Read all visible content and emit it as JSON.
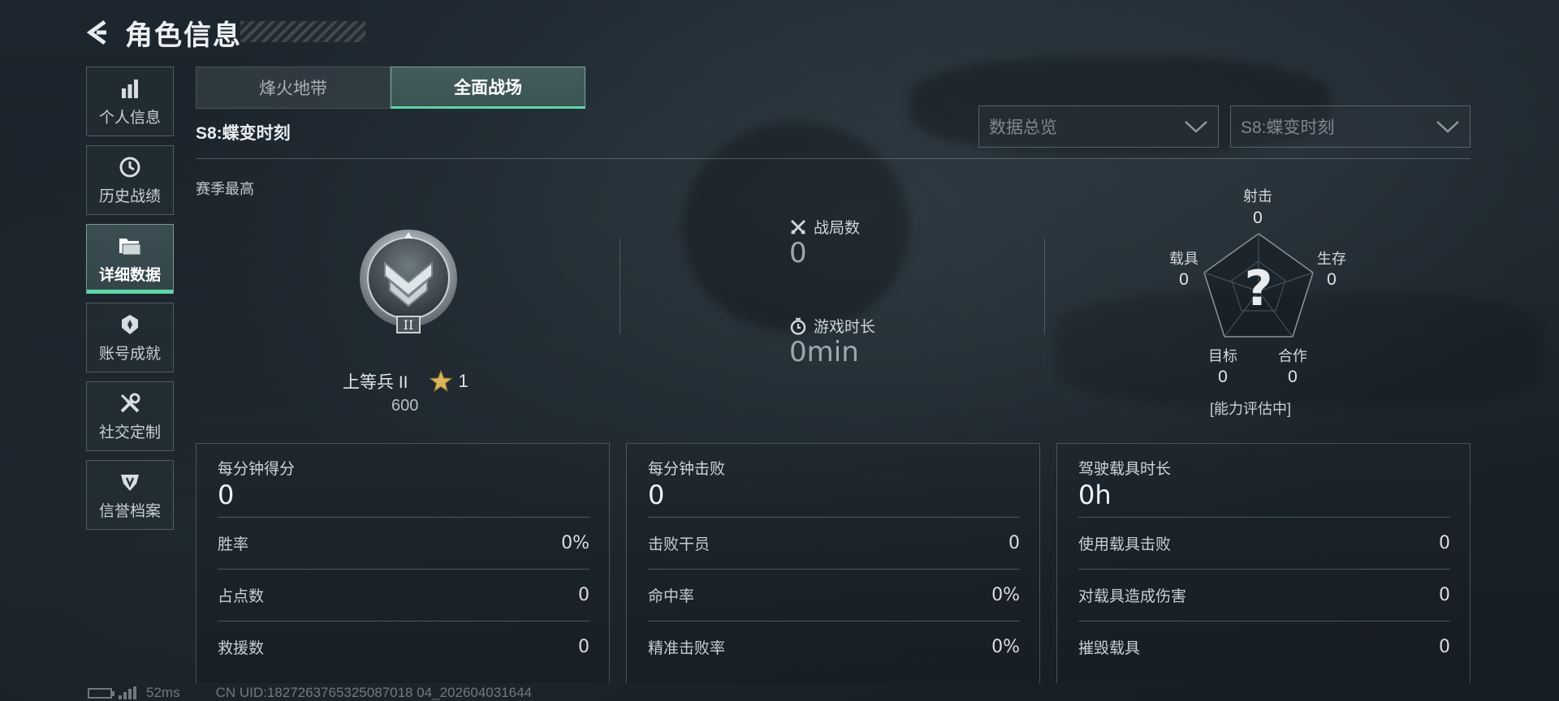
{
  "header": {
    "title": "角色信息",
    "back_icon": "back-arrow-icon"
  },
  "sidebar": {
    "items": [
      {
        "label": "个人信息",
        "icon": "bar-chart-icon",
        "active": false
      },
      {
        "label": "历史战绩",
        "icon": "clock-history-icon",
        "active": false
      },
      {
        "label": "详细数据",
        "icon": "folder-icon",
        "active": true
      },
      {
        "label": "账号成就",
        "icon": "achievement-icon",
        "active": false
      },
      {
        "label": "社交定制",
        "icon": "tools-icon",
        "active": false
      },
      {
        "label": "信誉档案",
        "icon": "credit-shield-icon",
        "active": false
      }
    ]
  },
  "tabs": [
    {
      "label": "烽火地带",
      "active": false
    },
    {
      "label": "全面战场",
      "active": true
    }
  ],
  "season_title": "S8:蝶变时刻",
  "filters": {
    "overview": "数据总览",
    "season": "S8:蝶变时刻"
  },
  "season_best": {
    "label": "赛季最高",
    "rank_name": "上等兵 II",
    "badge_numeral": "II",
    "stars": "1",
    "score": "600"
  },
  "summary": {
    "matches_label": "战局数",
    "matches_value": "0",
    "playtime_label": "游戏时长",
    "playtime_value": "0min"
  },
  "radar": {
    "axes": [
      {
        "name": "射击",
        "value": "0"
      },
      {
        "name": "生存",
        "value": "0"
      },
      {
        "name": "合作",
        "value": "0"
      },
      {
        "name": "目标",
        "value": "0"
      },
      {
        "name": "载具",
        "value": "0"
      }
    ],
    "center_mark": "?",
    "status": "[能力评估中]"
  },
  "panels": [
    {
      "title": "每分钟得分",
      "value": "0",
      "rows": [
        {
          "label": "胜率",
          "value": "0%"
        },
        {
          "label": "占点数",
          "value": "0"
        },
        {
          "label": "救援数",
          "value": "0"
        }
      ]
    },
    {
      "title": "每分钟击败",
      "value": "0",
      "rows": [
        {
          "label": "击败干员",
          "value": "0"
        },
        {
          "label": "命中率",
          "value": "0%"
        },
        {
          "label": "精准击败率",
          "value": "0%"
        }
      ]
    },
    {
      "title": "驾驶载具时长",
      "value": "0h",
      "rows": [
        {
          "label": "使用载具击败",
          "value": "0"
        },
        {
          "label": "对载具造成伤害",
          "value": "0"
        },
        {
          "label": "摧毁载具",
          "value": "0"
        }
      ]
    }
  ],
  "footer": {
    "ping": "52ms",
    "uid": "CN UID:1827263765325087018 04_202604031644"
  },
  "colors": {
    "accent": "#5fd6a6",
    "background": "#1b232b",
    "star": "#d9b45a"
  }
}
